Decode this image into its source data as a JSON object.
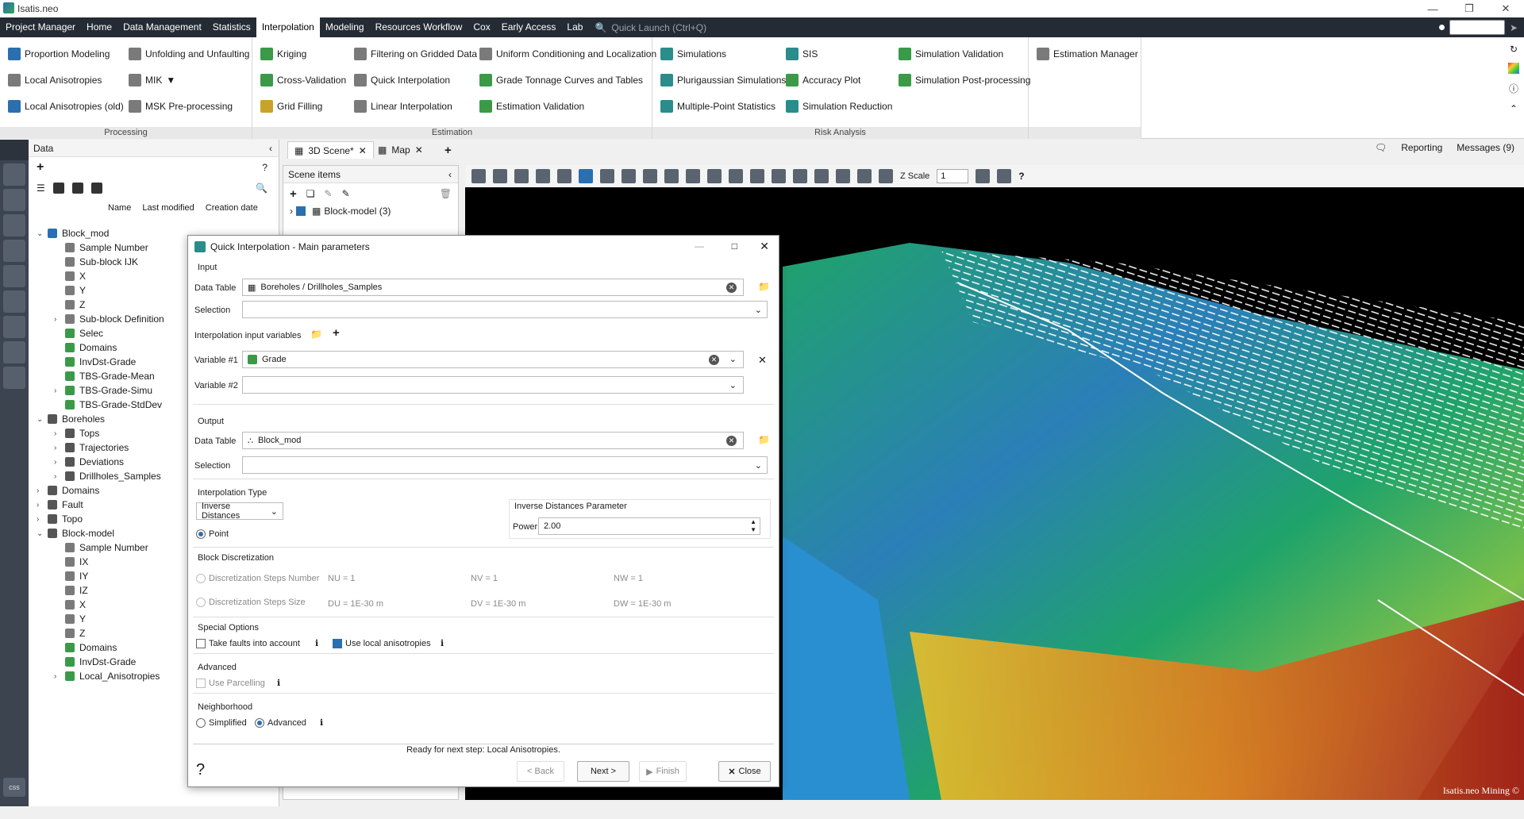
{
  "app": {
    "title": "Isatis.neo"
  },
  "menu": {
    "items": [
      "Project Manager",
      "Home",
      "Data Management",
      "Statistics",
      "Interpolation",
      "Modeling",
      "Resources Workflow",
      "Cox",
      "Early Access",
      "Lab"
    ],
    "active_index": 4,
    "quick_launch_placeholder": "Quick Launch (Ctrl+Q)"
  },
  "ribbon": {
    "processing": {
      "label": "Processing",
      "items": [
        "Proportion Modeling",
        "Unfolding and Unfaulting",
        "Local Anisotropies",
        "MIK",
        "Local Anisotropies (old)",
        "MSK Pre-processing"
      ]
    },
    "estimation": {
      "label": "Estimation",
      "items": [
        "Kriging",
        "Filtering on Gridded Data",
        "Uniform Conditioning and Localization",
        "Cross-Validation",
        "Quick Interpolation",
        "Grade Tonnage Curves and Tables",
        "Grid Filling",
        "Linear Interpolation",
        "Estimation Validation"
      ]
    },
    "risk": {
      "label": "Risk Analysis",
      "items": [
        "Simulations",
        "SIS",
        "Simulation Validation",
        "Plurigaussian Simulations",
        "Accuracy Plot",
        "Simulation Post-processing",
        "Multiple-Point Statistics",
        "Simulation Reduction"
      ]
    },
    "other": {
      "items": [
        "Estimation Manager"
      ]
    }
  },
  "right_bar": {
    "reporting": "Reporting",
    "messages": "Messages (9)"
  },
  "data_panel": {
    "title": "Data",
    "columns": [
      "Name",
      "Last modified",
      "Creation date"
    ],
    "tree": [
      {
        "label": "Block_mod",
        "level": 0,
        "expand": "v",
        "color": "#2a6fb0"
      },
      {
        "label": "Sample Number",
        "level": 1,
        "expand": "",
        "color": "#7a7a7a"
      },
      {
        "label": "Sub-block IJK",
        "level": 1,
        "expand": "",
        "color": "#7a7a7a"
      },
      {
        "label": "X",
        "level": 1,
        "expand": "",
        "color": "#7a7a7a"
      },
      {
        "label": "Y",
        "level": 1,
        "expand": "",
        "color": "#7a7a7a"
      },
      {
        "label": "Z",
        "level": 1,
        "expand": "",
        "color": "#7a7a7a"
      },
      {
        "label": "Sub-block Definition",
        "level": 1,
        "expand": ">",
        "color": "#7a7a7a"
      },
      {
        "label": "Selec",
        "level": 1,
        "expand": "",
        "color": "#3a9a48"
      },
      {
        "label": "Domains",
        "level": 1,
        "expand": "",
        "color": "#3a9a48"
      },
      {
        "label": "InvDst-Grade",
        "level": 1,
        "expand": "",
        "color": "#3a9a48"
      },
      {
        "label": "TBS-Grade-Mean",
        "level": 1,
        "expand": "",
        "color": "#3a9a48"
      },
      {
        "label": "TBS-Grade-Simu",
        "level": 1,
        "expand": ">",
        "color": "#3a9a48"
      },
      {
        "label": "TBS-Grade-StdDev",
        "level": 1,
        "expand": "",
        "color": "#3a9a48"
      },
      {
        "label": "Boreholes",
        "level": 0,
        "expand": "v",
        "color": "#555"
      },
      {
        "label": "Tops",
        "level": 1,
        "expand": ">",
        "color": "#555"
      },
      {
        "label": "Trajectories",
        "level": 1,
        "expand": ">",
        "color": "#555"
      },
      {
        "label": "Deviations",
        "level": 1,
        "expand": ">",
        "color": "#555"
      },
      {
        "label": "Drillholes_Samples",
        "level": 1,
        "expand": ">",
        "color": "#555"
      },
      {
        "label": "Domains",
        "level": 0,
        "expand": ">",
        "color": "#555"
      },
      {
        "label": "Fault",
        "level": 0,
        "expand": ">",
        "color": "#555"
      },
      {
        "label": "Topo",
        "level": 0,
        "expand": ">",
        "color": "#555"
      },
      {
        "label": "Block-model",
        "level": 0,
        "expand": "v",
        "color": "#555"
      },
      {
        "label": "Sample Number",
        "level": 1,
        "expand": "",
        "color": "#7a7a7a"
      },
      {
        "label": "IX",
        "level": 1,
        "expand": "",
        "color": "#7a7a7a"
      },
      {
        "label": "IY",
        "level": 1,
        "expand": "",
        "color": "#7a7a7a"
      },
      {
        "label": "IZ",
        "level": 1,
        "expand": "",
        "color": "#7a7a7a"
      },
      {
        "label": "X",
        "level": 1,
        "expand": "",
        "color": "#7a7a7a"
      },
      {
        "label": "Y",
        "level": 1,
        "expand": "",
        "color": "#7a7a7a"
      },
      {
        "label": "Z",
        "level": 1,
        "expand": "",
        "color": "#7a7a7a"
      },
      {
        "label": "Domains",
        "level": 1,
        "expand": "",
        "color": "#3a9a48"
      },
      {
        "label": "InvDst-Grade",
        "level": 1,
        "expand": "",
        "color": "#3a9a48"
      },
      {
        "label": "Local_Anisotropies",
        "level": 1,
        "expand": ">",
        "color": "#3a9a48"
      }
    ]
  },
  "tabs": [
    {
      "label": "3D Scene*"
    },
    {
      "label": "Map"
    }
  ],
  "scene_panel": {
    "title": "Scene items",
    "item": "Block-model (3)"
  },
  "toolbar3d": {
    "zscale_label": "Z Scale",
    "zscale_value": "1"
  },
  "viewer": {
    "watermark": "Isatis.neo Mining ©"
  },
  "dialog": {
    "title": "Quick Interpolation - Main parameters",
    "input": {
      "section": "Input",
      "data_table_label": "Data Table",
      "data_table_value": "Boreholes / Drillholes_Samples",
      "selection_label": "Selection",
      "selection_value": "",
      "vars_label": "Interpolation input variables",
      "var1_label": "Variable #1",
      "var1_value": "Grade",
      "var2_label": "Variable #2",
      "var2_value": ""
    },
    "output": {
      "section": "Output",
      "data_table_label": "Data Table",
      "data_table_value": "Block_mod",
      "selection_label": "Selection",
      "selection_value": ""
    },
    "interp": {
      "section": "Interpolation Type",
      "type_value": "Inverse Distances",
      "point_label": "Point",
      "param_section": "Inverse Distances Parameter",
      "power_label": "Power",
      "power_value": "2.00"
    },
    "block": {
      "section": "Block Discretization",
      "steps_number_label": "Discretization Steps Number",
      "nu": "NU = 1",
      "nv": "NV = 1",
      "nw": "NW = 1",
      "steps_size_label": "Discretization Steps Size",
      "du": "DU = 1E-30 m",
      "dv": "DV = 1E-30 m",
      "dw": "DW = 1E-30 m"
    },
    "special": {
      "section": "Special Options",
      "faults_label": "Take faults into account",
      "aniso_label": "Use local anisotropies"
    },
    "advanced": {
      "section": "Advanced",
      "parcelling_label": "Use Parcelling"
    },
    "neighborhood": {
      "section": "Neighborhood",
      "simplified_label": "Simplified",
      "advanced_label": "Advanced"
    },
    "status": "Ready for next step: Local Anisotropies.",
    "buttons": {
      "back": "< Back",
      "next": "Next >",
      "finish": "Finish",
      "close": "Close"
    }
  }
}
